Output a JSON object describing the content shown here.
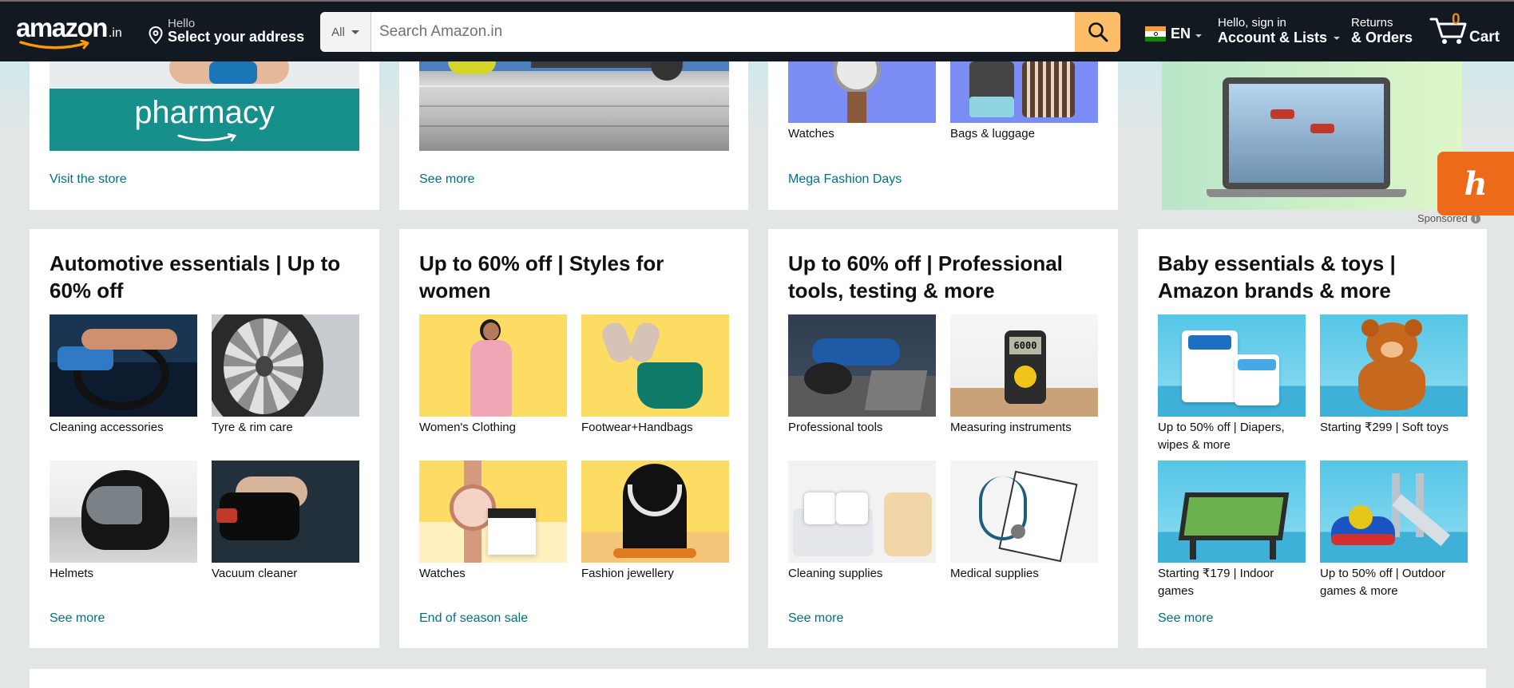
{
  "header": {
    "logo_text": "amazon",
    "logo_suffix": ".in",
    "address_hello": "Hello",
    "address_select": "Select your address",
    "search_category": "All",
    "search_placeholder": "Search Amazon.in",
    "language": "EN",
    "account_line1": "Hello, sign in",
    "account_line2": "Account & Lists",
    "returns_line1": "Returns",
    "returns_line2": "& Orders",
    "cart_count": "0",
    "cart_label": "Cart",
    "colors": {
      "nav_bg": "#131921",
      "search_button": "#febd69",
      "cart_count": "#f08804",
      "link": "#007185"
    }
  },
  "top_cards": [
    {
      "image_text": "pharmacy",
      "link": "Visit the store"
    },
    {
      "link": "See more"
    },
    {
      "tiles": [
        {
          "caption": "Watches"
        },
        {
          "caption": "Bags & luggage"
        }
      ],
      "link": "Mega Fashion Days"
    }
  ],
  "ad": {
    "sponsored": "Sponsored",
    "honey_glyph": "h"
  },
  "cards": [
    {
      "title": "Automotive essentials | Up to 60% off",
      "tiles": [
        {
          "caption": "Cleaning accessories",
          "icon": "car-cleaning-image"
        },
        {
          "caption": "Tyre & rim care",
          "icon": "tyre-image"
        },
        {
          "caption": "Helmets",
          "icon": "helmet-image"
        },
        {
          "caption": "Vacuum cleaner",
          "icon": "vacuum-image"
        }
      ],
      "link": "See more"
    },
    {
      "title": "Up to 60% off | Styles for women",
      "tiles": [
        {
          "caption": "Women's Clothing",
          "icon": "dress-image"
        },
        {
          "caption": "Footwear+Handbags",
          "icon": "handbag-image"
        },
        {
          "caption": "Watches",
          "icon": "watch-image"
        },
        {
          "caption": "Fashion jewellery",
          "icon": "necklace-image"
        }
      ],
      "link": "End of season sale"
    },
    {
      "title": "Up to 60% off | Professional tools, testing & more",
      "tiles": [
        {
          "caption": "Professional tools",
          "icon": "grinder-image"
        },
        {
          "caption": "Measuring instruments",
          "icon": "multimeter-image",
          "display": "6000"
        },
        {
          "caption": "Cleaning supplies",
          "icon": "cleaning-supplies-image"
        },
        {
          "caption": "Medical supplies",
          "icon": "stethoscope-image"
        }
      ],
      "link": "See more"
    },
    {
      "title": "Baby essentials & toys | Amazon brands & more",
      "tiles": [
        {
          "caption": "Up to 50% off | Diapers, wipes & more",
          "icon": "diapers-image"
        },
        {
          "caption": "Starting ₹299 | Soft toys",
          "icon": "teddy-image"
        },
        {
          "caption": "Starting ₹179 | Indoor games",
          "icon": "foosball-image"
        },
        {
          "caption": "Up to 50% off | Outdoor games & more",
          "icon": "slide-image"
        }
      ],
      "link": "See more"
    }
  ]
}
